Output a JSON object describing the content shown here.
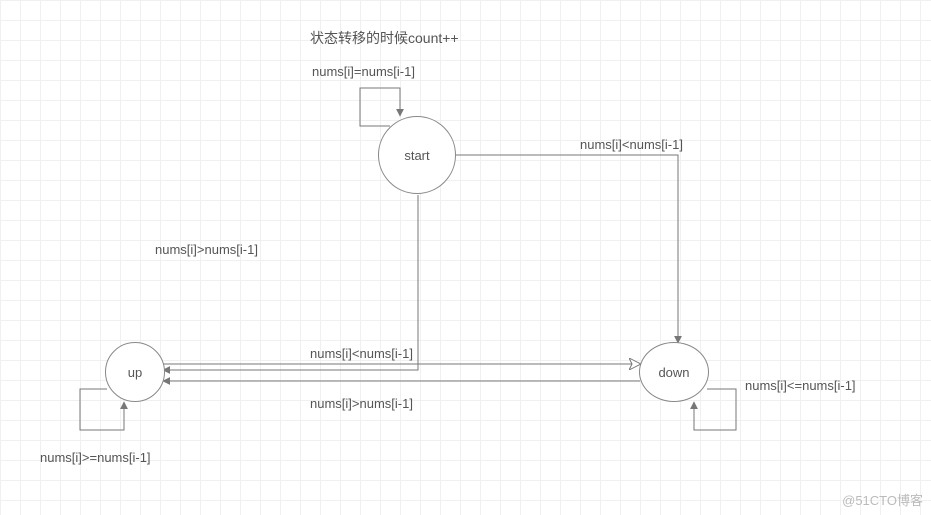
{
  "title": "状态转移的时候count++",
  "nodes": {
    "start": "start",
    "up": "up",
    "down": "down"
  },
  "edges": {
    "start_self": "nums[i]=nums[i-1]",
    "start_to_down": "nums[i]<nums[i-1]",
    "start_to_up": "nums[i]>nums[i-1]",
    "up_to_down": "nums[i]<nums[i-1]",
    "down_to_up": "nums[i]>nums[i-1]",
    "up_self": "nums[i]>=nums[i-1]",
    "down_self": "nums[i]<=nums[i-1]"
  },
  "watermark": "@51CTO博客"
}
